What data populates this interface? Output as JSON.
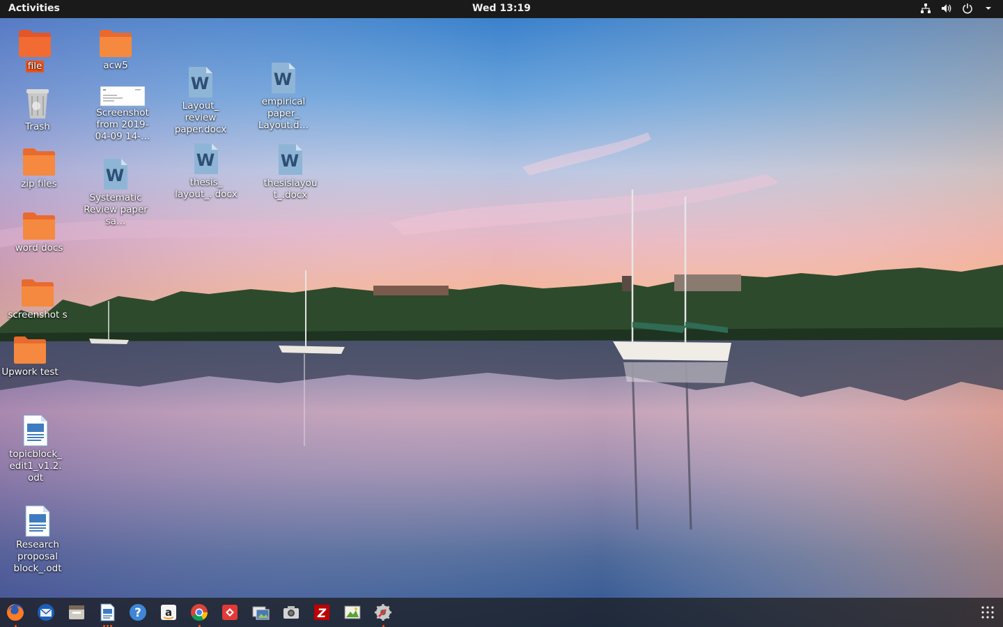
{
  "topbar": {
    "activities": "Activities",
    "clock": "Wed 13:19",
    "tray": [
      "network-icon",
      "volume-icon",
      "power-icon",
      "menu-arrow-icon"
    ]
  },
  "desktop": {
    "selected": "file",
    "icons": {
      "file": {
        "label": "file",
        "kind": "folder"
      },
      "acw5": {
        "label": "acw5",
        "kind": "folder"
      },
      "trash": {
        "label": "Trash",
        "kind": "trash"
      },
      "screenshot_img": {
        "label": "Screenshot from 2019-04-09 14-…",
        "kind": "image"
      },
      "layout_review": {
        "label": "Layout_ review paper.docx",
        "kind": "word-doc"
      },
      "empirical": {
        "label": "empirical paper_ Layout.d…",
        "kind": "word-doc"
      },
      "zip_files": {
        "label": "zip files",
        "kind": "folder"
      },
      "systematic": {
        "label": "Systematic Review paper sa…",
        "kind": "word-doc"
      },
      "thesis_layout": {
        "label": "thesis_ layout_. docx",
        "kind": "word-doc"
      },
      "thesislayout": {
        "label": "thesislayou t_.docx",
        "kind": "word-doc"
      },
      "word_docs": {
        "label": "word docs",
        "kind": "folder"
      },
      "screenshots": {
        "label": "screenshot s",
        "kind": "folder"
      },
      "upwork": {
        "label": "Upwork test",
        "kind": "folder"
      },
      "topicblock": {
        "label": "topicblock_ edit1_v1.2. odt",
        "kind": "odt-doc"
      },
      "research": {
        "label": "Research proposal block_.odt",
        "kind": "odt-doc"
      }
    }
  },
  "dock": {
    "items": [
      "firefox-icon",
      "thunderbird-icon",
      "files-icon",
      "libreoffice-writer-icon",
      "help-icon",
      "amazon-icon",
      "chrome-icon",
      "anydesk-icon",
      "image-viewer-icon",
      "camera-icon",
      "filezilla-icon",
      "image-editor-icon",
      "system-settings-icon"
    ],
    "show_apps": "show-applications-icon"
  },
  "colors": {
    "topbar": "#1a1a1a",
    "ubuntu_orange": "#e95420",
    "folder": "#f07f3e",
    "word_blue": "#6f9fc6"
  }
}
